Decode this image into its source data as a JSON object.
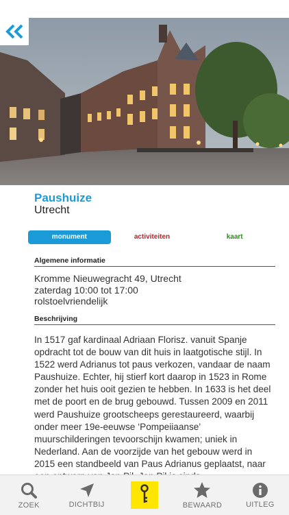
{
  "monument": {
    "title": "Paushuize",
    "city": "Utrecht"
  },
  "tabs": [
    {
      "label": "monument",
      "active": true,
      "color": "#1a9bd7"
    },
    {
      "label": "activiteiten",
      "active": false,
      "color": "#b0252a"
    },
    {
      "label": "kaart",
      "active": false,
      "color": "#2e8b22"
    }
  ],
  "general": {
    "heading": "Algemene informatie",
    "address": "Kromme Nieuwegracht 49, Utrecht",
    "hours": "zaterdag 10:00 tot 17:00",
    "accessibility": "rolstoelvriendelijk"
  },
  "description": {
    "heading": "Beschrijving",
    "text": "In 1517 gaf kardinaal Adriaan Florisz. vanuit Spanje opdracht tot de bouw van dit huis in laatgotische stijl. In 1522 werd Adrianus tot paus verkozen, vandaar de naam Paushuize. Echter, hij stierf kort daarop in 1523 in Rome zonder het huis ooit gezien te hebben. In 1633 is het deel met de poort en de brug gebouwd. Tussen 2009 en 2011 werd Paushuize grootscheeps gerestaureerd, waarbij onder meer 19e-eeuwse ‘Pompeiiaanse’ muurschilderingen tevoorschijn kwamen; uniek in Nederland. Aan de voorzijde van het gebouw werd in 2015 een standbeeld van Paus Adrianus geplaatst, naar een ontwerp van Jan Pil. Jan Pil is sinds ...  "
  },
  "tabbar": [
    {
      "label": "ZOEK",
      "icon": "search-icon"
    },
    {
      "label": "DICHTBIJ",
      "icon": "location-arrow-icon"
    },
    {
      "label": "",
      "icon": "key-icon",
      "active": true
    },
    {
      "label": "BEWAARD",
      "icon": "star-icon"
    },
    {
      "label": "UITLEG",
      "icon": "info-icon"
    }
  ],
  "colors": {
    "accent": "#1a9bd7",
    "activities": "#b0252a",
    "map": "#2e8b22",
    "key_highlight": "#ffe600"
  }
}
